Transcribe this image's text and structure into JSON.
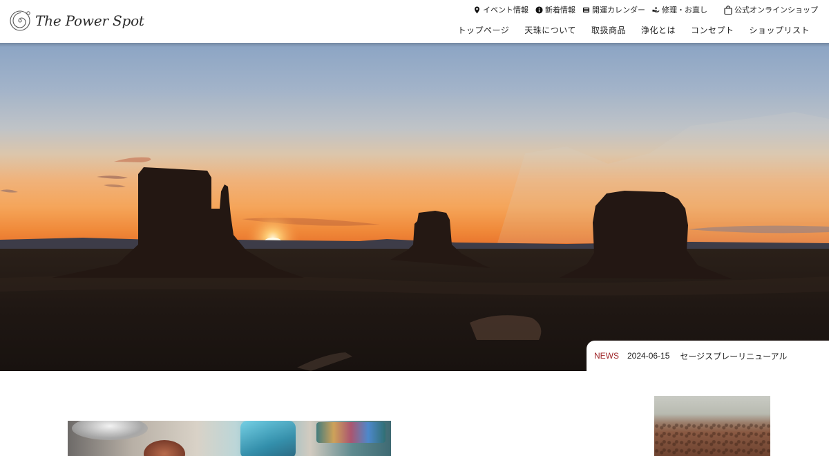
{
  "brand": {
    "name": "The Power Spot",
    "logo_icon": "spiral-logo-icon"
  },
  "utility_nav": [
    {
      "label": "イベント情報",
      "icon": "map-pin-icon"
    },
    {
      "label": "新着情報",
      "icon": "info-icon"
    },
    {
      "label": "開運カレンダー",
      "icon": "calendar-book-icon"
    },
    {
      "label": "修理・お直し",
      "icon": "repair-hand-icon"
    }
  ],
  "shop_link": {
    "label": "公式オンラインショップ",
    "icon": "shopping-bag-icon"
  },
  "main_nav": [
    "トップページ",
    "天珠について",
    "取扱商品",
    "浄化とは",
    "コンセプト",
    "ショップリスト"
  ],
  "news": {
    "label": "NEWS",
    "date": "2024-06-15",
    "title": "セージスプレーリニューアル"
  },
  "colors": {
    "news_label": "#a0282b",
    "text": "#222222",
    "background": "#ffffff"
  }
}
